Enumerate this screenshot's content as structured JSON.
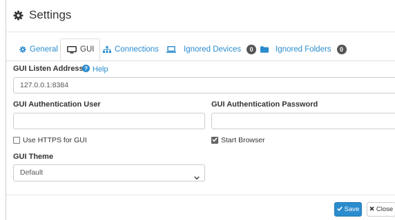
{
  "header": {
    "title": "Settings",
    "icon": "gear-icon"
  },
  "tabs": [
    {
      "label": "General",
      "icon": "gear-icon"
    },
    {
      "label": "GUI",
      "icon": "desktop-icon",
      "active": true
    },
    {
      "label": "Connections",
      "icon": "sitemap-icon"
    },
    {
      "label": "Ignored Devices",
      "icon": "laptop-icon",
      "badge": "0"
    },
    {
      "label": "Ignored Folders",
      "icon": "folder-icon",
      "badge": "0"
    }
  ],
  "gui": {
    "listen_label": "GUI Listen Address",
    "help_label": "Help",
    "listen_value": "127.0.0.1:8384",
    "user_label": "GUI Authentication User",
    "user_value": "",
    "password_label": "GUI Authentication Password",
    "password_value": "",
    "https_label": "Use HTTPS for GUI",
    "https_checked": false,
    "browser_label": "Start Browser",
    "browser_checked": true,
    "theme_label": "GUI Theme",
    "theme_value": "Default"
  },
  "footer": {
    "save_label": "Save",
    "close_label": "Close"
  },
  "colors": {
    "accent": "#2a8ccd",
    "badge": "#555555",
    "border": "#cccccc"
  }
}
